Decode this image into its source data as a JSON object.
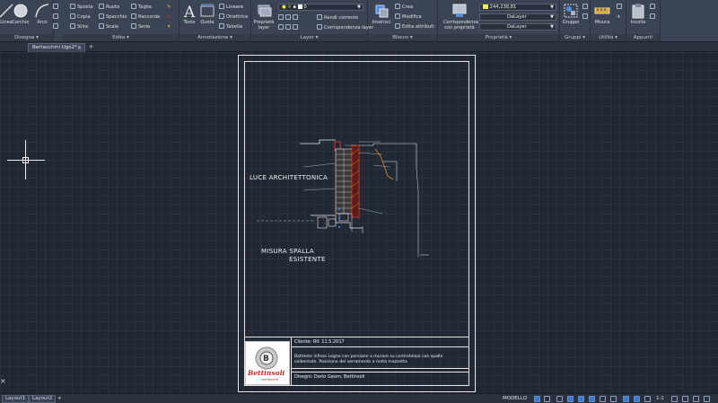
{
  "ribbon": {
    "disegna": {
      "title": "Disegna ▾",
      "linea": "Linea",
      "cerchio": "Cerchio",
      "arco": "Arco"
    },
    "edita": {
      "title": "Edita ▾",
      "sposta": "Sposta",
      "ruota": "Ruota",
      "taglia": "Taglia",
      "copia": "Copia",
      "specchio": "Specchio",
      "raccorda": "Raccorda",
      "stira": "Stira",
      "scala": "Scala",
      "serie": "Serie"
    },
    "annotazione": {
      "title": "Annotazione ▾",
      "testo": "Testo",
      "quota": "Quota",
      "lineare": "Lineare",
      "direttrice": "Direttrice",
      "tabella": "Tabella"
    },
    "layer": {
      "title": "Layer ▾",
      "proprieta_layer": "Proprietà layer",
      "layer_value": "0",
      "rendi_corrente": "Rendi corrente",
      "corrispondenza_layer": "Corrispondenza layer"
    },
    "blocco": {
      "title": "Blocco ▾",
      "inserisci": "Inserisci",
      "crea": "Crea",
      "modifica": "Modifica",
      "edita_attributi": "Edita attributi"
    },
    "proprieta": {
      "title": "Proprietà ▾",
      "corrispondenza_proprieta": "Corrispondenza con proprietà",
      "color_value": "244,238,81",
      "linetype_value": "DaLayer",
      "lineweight_value": "DaLayer"
    },
    "gruppi": {
      "title": "Gruppi ▾",
      "gruppo": "Gruppo"
    },
    "utilita": {
      "title": "Utilità ▾",
      "misura": "Misura"
    },
    "appunti": {
      "title": "Appunti",
      "incolla": "Incolla"
    }
  },
  "tabs": {
    "document": "Bertacchini Ugo2*",
    "close": "×",
    "add": "+"
  },
  "drawing": {
    "label_luce": "LUCE ARCHITETTONICA",
    "label_misura_1": "MISURA SPALLA",
    "label_misura_2": "ESISTENTE",
    "titleblock": {
      "cliente": "Cliente: Rif. 11.5.2017",
      "descrizione_1": "Battente infisso Legno con persiane a murare su controtelaio con spalle",
      "descrizione_2": "coibentate. Posizione del serramento a metà mazzetta",
      "disegni": "Disegni: Dario Geom. Bettinsoli",
      "logo_text": "Bettinsoli",
      "logo_sub": "serramenti"
    }
  },
  "side": {
    "close_x": "×"
  },
  "statusbar": {
    "layout1": "Layout1",
    "layout2": "Layout2",
    "add": "+",
    "model": "MODELLO",
    "scale": "1:1"
  },
  "colors": {
    "canvas_bg": "#212833",
    "ribbon_bg": "#3b4453",
    "accent_blue": "#3f78c8",
    "layer_yellow": "#f4ee51",
    "drawing_red": "#d9342b"
  }
}
